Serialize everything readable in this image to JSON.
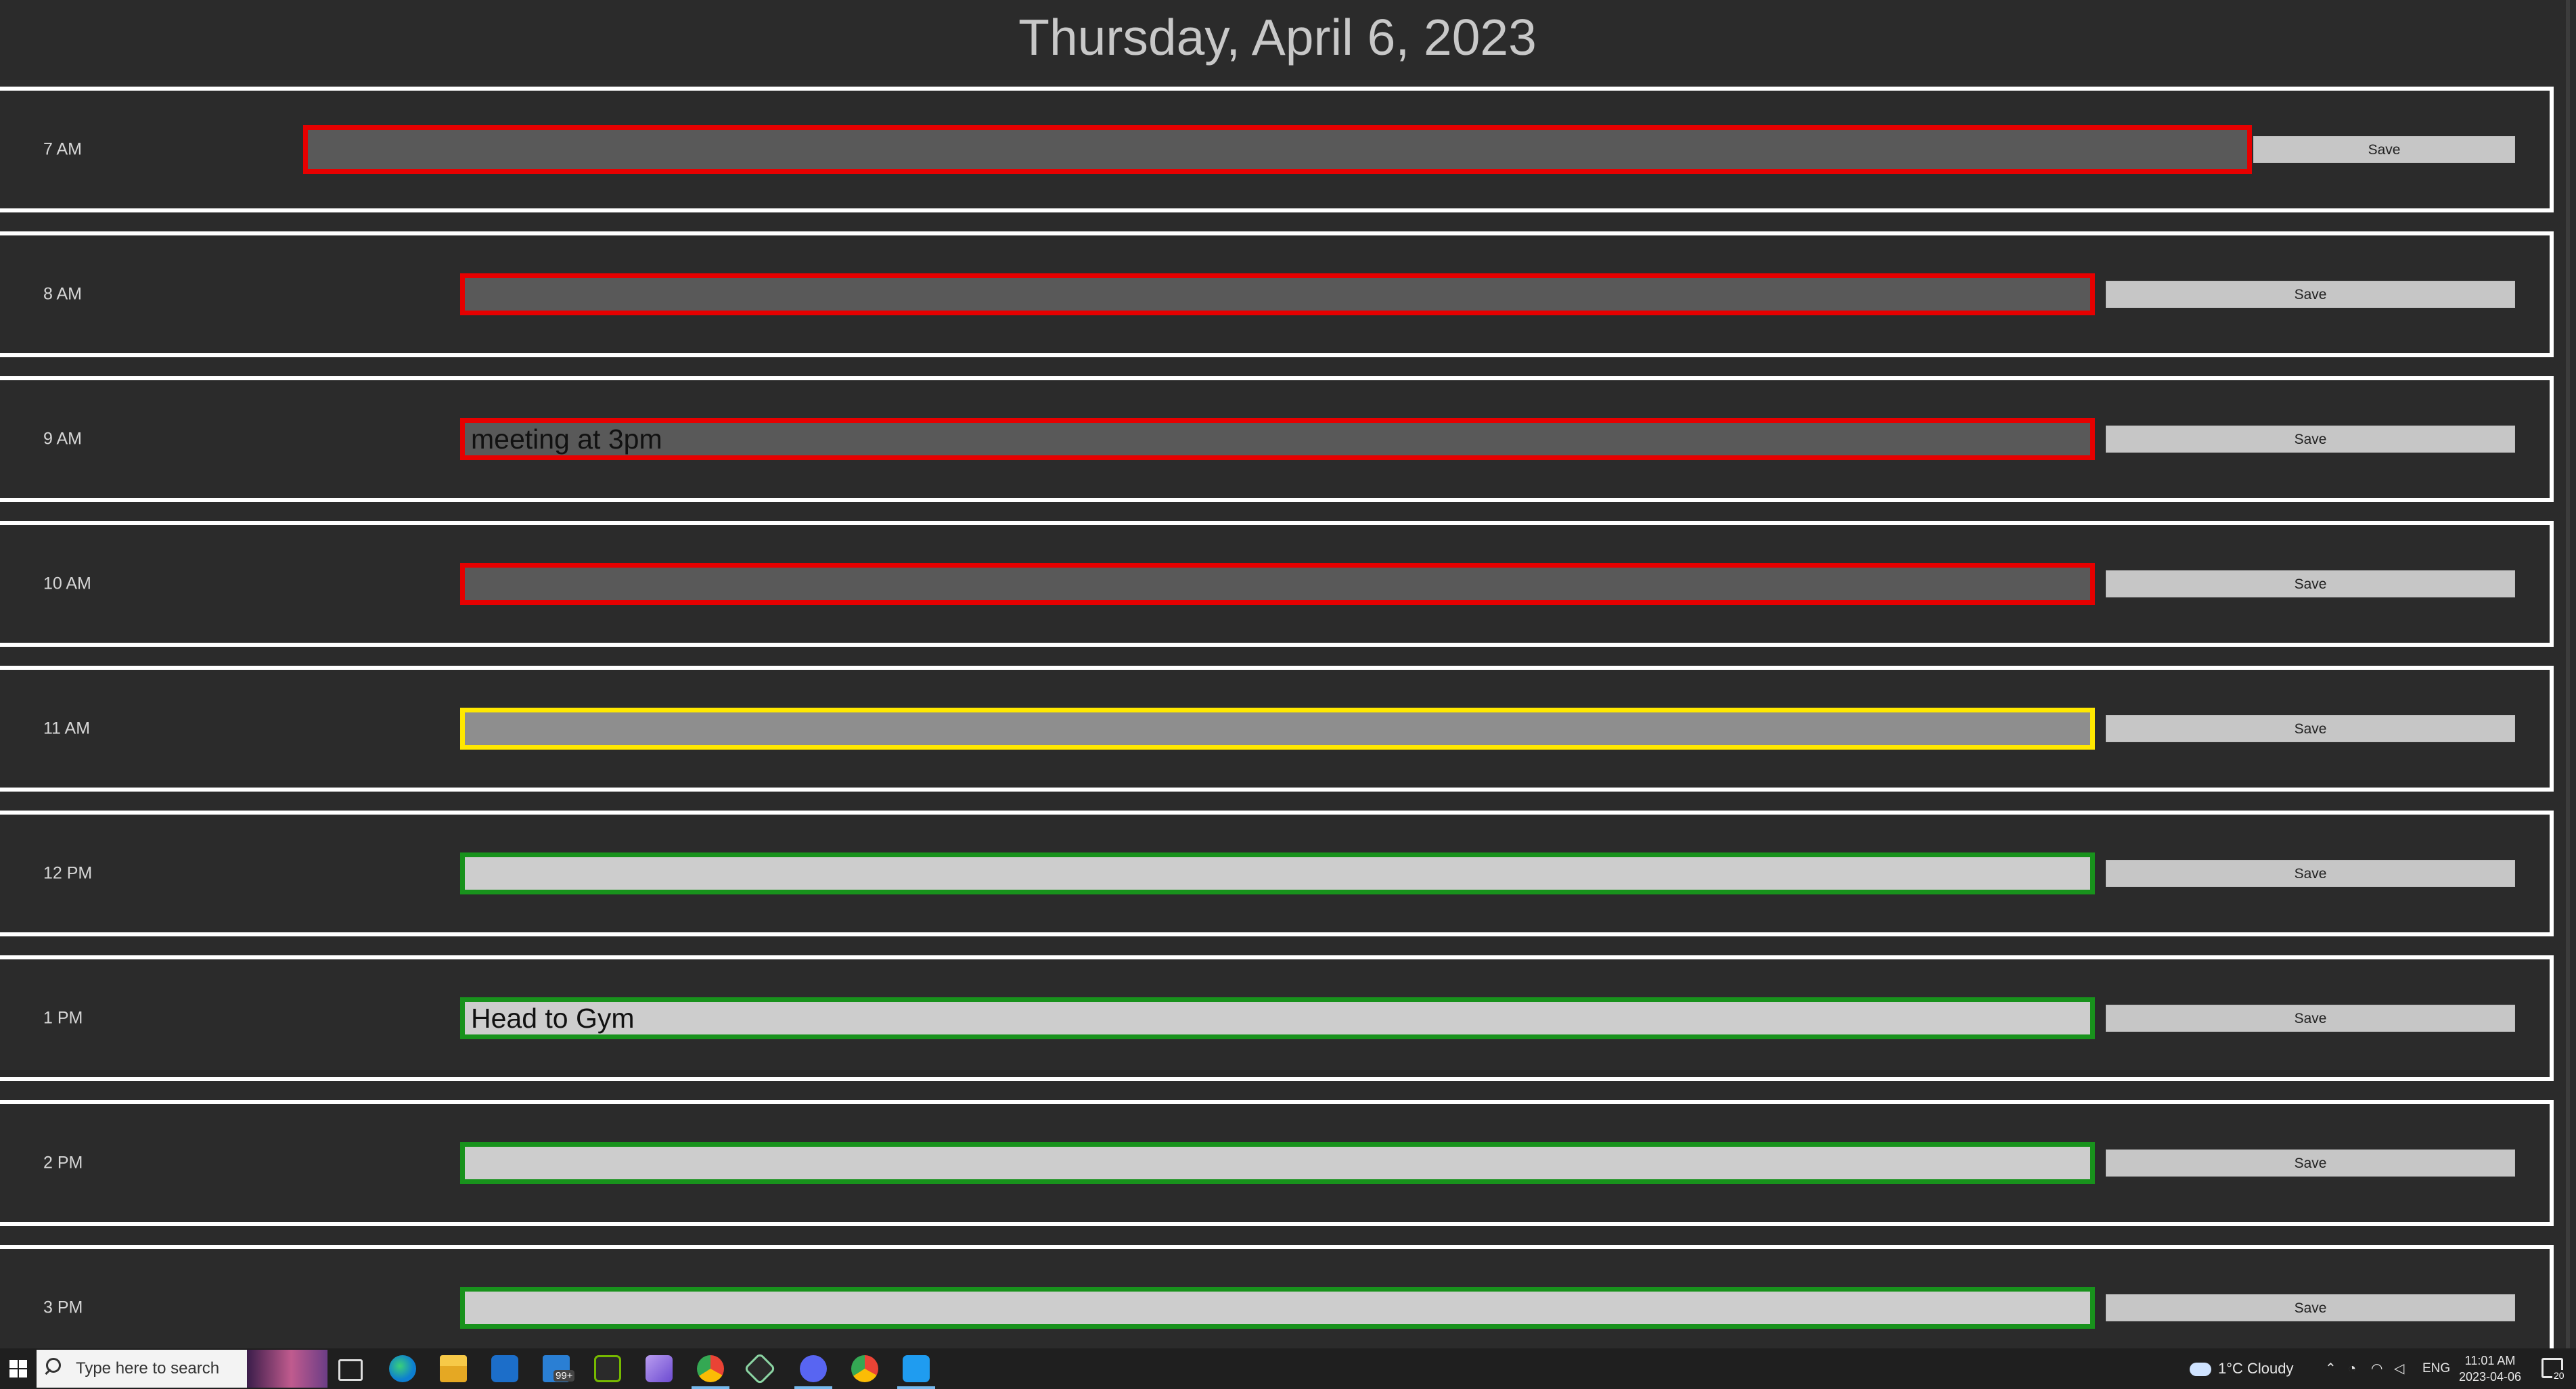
{
  "header": {
    "date": "Thursday, April 6, 2023"
  },
  "hours": [
    {
      "label": "7 AM",
      "text": "",
      "state": "past",
      "save": "Save"
    },
    {
      "label": "8 AM",
      "text": "",
      "state": "past",
      "save": "Save"
    },
    {
      "label": "9 AM",
      "text": "meeting at 3pm",
      "state": "past",
      "save": "Save"
    },
    {
      "label": "10 AM",
      "text": "",
      "state": "past",
      "save": "Save"
    },
    {
      "label": "11 AM",
      "text": "",
      "state": "present",
      "save": "Save"
    },
    {
      "label": "12 PM",
      "text": "",
      "state": "future",
      "save": "Save"
    },
    {
      "label": "1 PM",
      "text": "Head to Gym",
      "state": "future",
      "save": "Save"
    },
    {
      "label": "2 PM",
      "text": "",
      "state": "future",
      "save": "Save"
    },
    {
      "label": "3 PM",
      "text": "",
      "state": "future",
      "save": "Save"
    }
  ],
  "colors": {
    "past_fill": "#595959",
    "past_border": "#e60000",
    "present_fill": "#8e8e8e",
    "present_border": "#ffe800",
    "future_fill": "#cdcdcd",
    "future_border": "#18921c"
  },
  "taskbar": {
    "search_placeholder": "Type here to search",
    "mail_badge": "99+",
    "apps": [
      "start-icon",
      "task-view-icon",
      "edge-icon",
      "file-explorer-icon",
      "store-icon",
      "mail-icon",
      "nvidia-icon",
      "visual-studio-icon",
      "chrome-icon",
      "git-icon",
      "discord-icon",
      "chrome-icon",
      "vscode-icon"
    ],
    "weather": "1°C  Cloudy",
    "language": "ENG",
    "time": "11:01 AM",
    "date": "2023-04-06",
    "notifications": "20"
  }
}
